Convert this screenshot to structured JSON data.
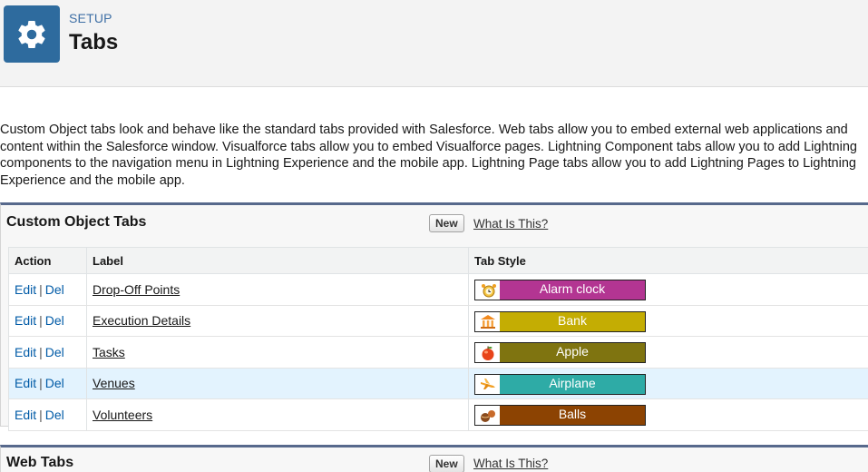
{
  "header": {
    "breadcrumb": "SETUP",
    "title": "Tabs",
    "icon": "gear-icon"
  },
  "description": "Custom Object tabs look and behave like the standard tabs provided with Salesforce. Web tabs allow you to embed external web applications and content within the Salesforce window. Visualforce tabs allow you to embed Visualforce pages. Lightning Component tabs allow you to add Lightning components to the navigation menu in Lightning Experience and the mobile app. Lightning Page tabs allow you to add Lightning Pages to Lightning Experience and the mobile app.",
  "custom_object_tabs": {
    "title": "Custom Object Tabs",
    "new_label": "New",
    "help_label": "What Is This?",
    "columns": [
      "Action",
      "Label",
      "Tab Style"
    ],
    "edit_label": "Edit",
    "del_label": "Del",
    "separator": "|",
    "rows": [
      {
        "label": "Drop-Off Points",
        "style": "Alarm clock",
        "color": "#b33592",
        "icon": "alarm-clock-icon"
      },
      {
        "label": "Execution Details",
        "style": "Bank",
        "color": "#c4ad03",
        "icon": "bank-icon"
      },
      {
        "label": "Tasks",
        "style": "Apple",
        "color": "#7f7410",
        "icon": "apple-icon"
      },
      {
        "label": "Venues",
        "style": "Airplane",
        "color": "#2eaba6",
        "icon": "airplane-icon"
      },
      {
        "label": "Volunteers",
        "style": "Balls",
        "color": "#8c4302",
        "icon": "balls-icon"
      }
    ]
  },
  "web_tabs": {
    "title": "Web Tabs",
    "new_label": "New",
    "help_label": "What Is This?"
  }
}
